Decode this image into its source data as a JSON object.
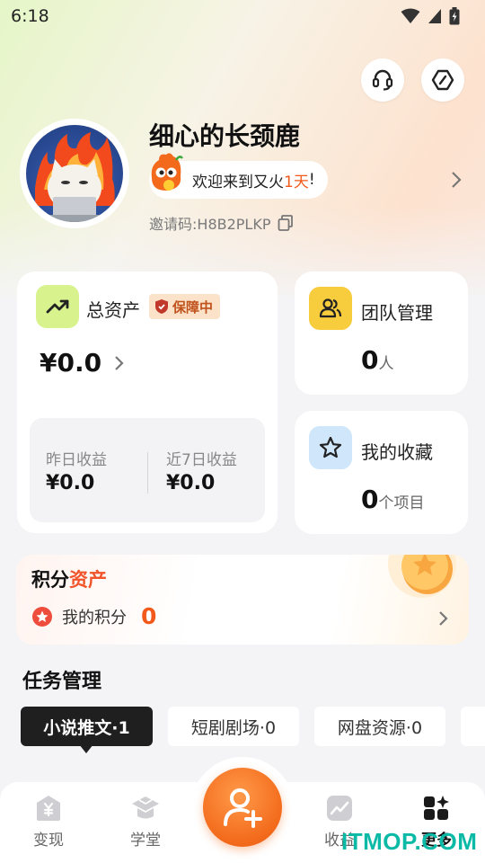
{
  "status_bar": {
    "time": "6:18"
  },
  "profile": {
    "username": "细心的长颈鹿",
    "welcome_prefix": "欢迎来到又火",
    "welcome_days": "1天",
    "welcome_suffix": "!",
    "invite_label": "邀请码:",
    "invite_code": "H8B2PLKP"
  },
  "assets_card": {
    "title": "总资产",
    "badge": "保障中",
    "total": "¥0.0",
    "yesterday_label": "昨日收益",
    "yesterday_value": "¥0.0",
    "week_label": "近7日收益",
    "week_value": "¥0.0"
  },
  "team_card": {
    "title": "团队管理",
    "count": "0",
    "unit": "人"
  },
  "favorites_card": {
    "title": "我的收藏",
    "count": "0",
    "unit": "个项目"
  },
  "points_card": {
    "title_prefix": "积分",
    "title_highlight": "资产",
    "label": "我的积分",
    "value": "0"
  },
  "tasks": {
    "title": "任务管理",
    "tabs": [
      {
        "label": "小说推文·1",
        "active": true
      },
      {
        "label": "短剧剧场·0",
        "active": false
      },
      {
        "label": "网盘资源·0",
        "active": false
      }
    ]
  },
  "bottom_nav": {
    "items": [
      {
        "label": "变现",
        "icon": "cash-icon"
      },
      {
        "label": "学堂",
        "icon": "school-icon"
      },
      {
        "label": "收益",
        "icon": "earnings-icon"
      },
      {
        "label": "更多",
        "icon": "more-icon"
      }
    ]
  },
  "watermark": "ITMOP.COM",
  "colors": {
    "accent": "#f36a1b",
    "points_highlight": "#f0542a"
  }
}
